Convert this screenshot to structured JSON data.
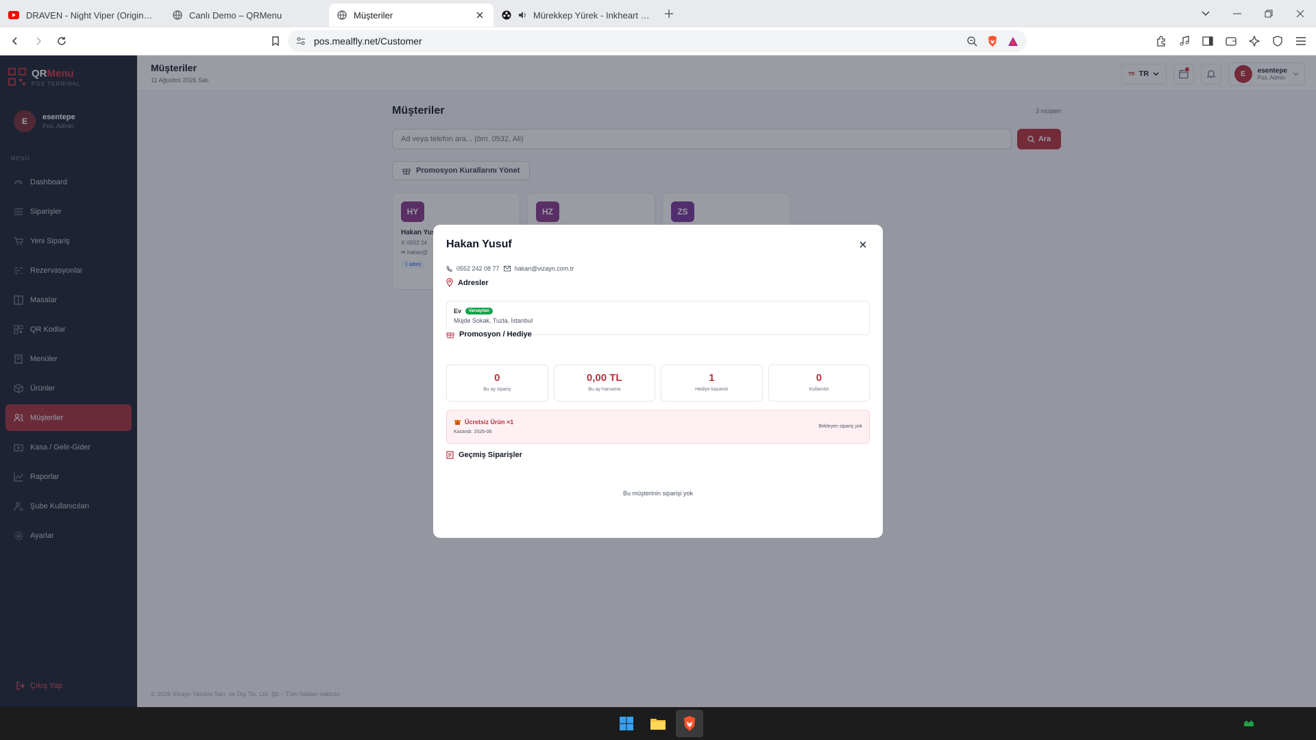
{
  "browser": {
    "tabs": [
      {
        "title": "DRAVEN - Night Viper (Original Mix)",
        "icon": "youtube-icon",
        "active": false
      },
      {
        "title": "Canlı Demo – QRMenu",
        "icon": "globe-icon",
        "active": false
      },
      {
        "title": "Müşteriler",
        "icon": "globe-icon",
        "active": true
      },
      {
        "title": "Mürekkep Yürek - Inkheart Full H",
        "icon": "film-icon",
        "active": false
      }
    ],
    "url": "pos.mealfly.net/Customer"
  },
  "app": {
    "brand": {
      "name_a": "QR",
      "name_b": "Menu",
      "subtitle": "POS TERMINAL"
    },
    "user": {
      "initial": "E",
      "name": "esentepe",
      "role": "Pos. Admin"
    },
    "menu_label": "MENÜ",
    "menu": [
      {
        "label": "Dashboard",
        "icon": "dashboard-icon"
      },
      {
        "label": "Siparişler",
        "icon": "list-icon"
      },
      {
        "label": "Yeni Sipariş",
        "icon": "cart-icon"
      },
      {
        "label": "Rezervasyonlar",
        "icon": "calendar-icon"
      },
      {
        "label": "Masalar",
        "icon": "table-icon"
      },
      {
        "label": "QR Kodlar",
        "icon": "qr-icon"
      },
      {
        "label": "Menüler",
        "icon": "book-icon"
      },
      {
        "label": "Ürünler",
        "icon": "box-icon"
      },
      {
        "label": "Müşteriler",
        "icon": "users-icon",
        "active": true
      },
      {
        "label": "Kasa / Gelir-Gider",
        "icon": "wallet-icon"
      },
      {
        "label": "Raporlar",
        "icon": "chart-icon"
      },
      {
        "label": "Şube Kullanıcıları",
        "icon": "user-cog-icon"
      },
      {
        "label": "Ayarlar",
        "icon": "gear-icon"
      }
    ],
    "logout": "Çıkış Yap",
    "header": {
      "title": "Müşteriler",
      "date": "11 Ağustos 2026 Salı",
      "lang": "TR",
      "lang_flag": "TR",
      "user_initial": "E",
      "user_name": "esentepe",
      "user_role": "Pos. Admin"
    },
    "page": {
      "title": "Müşteriler",
      "count": "3 müşteri",
      "search_placeholder": "Ad veya telefon ara... (örn. 0532, Ali)",
      "search_button": "Ara",
      "promo_button": "Promosyon Kurallarını Yönet",
      "customers": [
        {
          "initials": "HY",
          "name": "Hakan Yusuf",
          "phone": "0552 24",
          "email": "hakan@",
          "tag": "1 adres"
        },
        {
          "initials": "HZ",
          "name": "",
          "phone": "",
          "email": "",
          "tag": ""
        },
        {
          "initials": "ZS",
          "name": "",
          "phone": "",
          "email": "",
          "tag": ""
        }
      ]
    },
    "footer": "© 2026 Vizayn Yazılım San. ve Dış Tic. Ltd. Şti. - Tüm hakları saklıdır."
  },
  "modal": {
    "title": "Hakan Yusuf",
    "phone": "0552 242 08 77",
    "email": "hakan@vizayn.com.tr",
    "addresses_title": "Adresler",
    "address": {
      "label": "Ev",
      "badge": "Varsayılan",
      "text": "Müjde Sokak, Tuzla, İstanbul"
    },
    "promo_title": "Promosyon / Hediye",
    "stats": [
      {
        "value": "0",
        "label": "Bu ay sipariş"
      },
      {
        "value": "0,00 TL",
        "label": "Bu ay harcama"
      },
      {
        "value": "1",
        "label": "Hediye kazandı"
      },
      {
        "value": "0",
        "label": "Kullanıldı"
      }
    ],
    "gift": {
      "title": "Ücretsiz Ürün ×1",
      "earned": "Kazandı: 2026-08",
      "status": "Bekleyen sipariş yok"
    },
    "orders_title": "Geçmiş Siparişler",
    "orders_empty": "Bu müşterinin siparişi yok"
  },
  "colors": {
    "primary": "#b8323f",
    "sidebar": "#1e2433",
    "success": "#16a34a"
  }
}
